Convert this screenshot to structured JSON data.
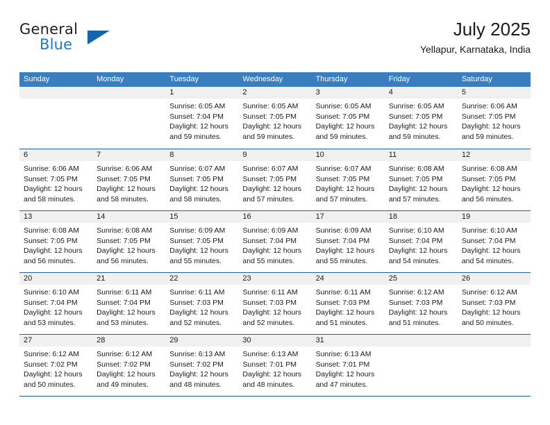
{
  "brand": {
    "name_top": "General",
    "name_bottom": "Blue",
    "triangle_icon": "triangle-icon",
    "color_dark": "#231f20",
    "color_blue": "#1f7ac4",
    "triangle_color": "#1565ac"
  },
  "header": {
    "title": "July 2025",
    "subtitle": "Yellapur, Karnataka, India"
  },
  "theme": {
    "header_bar": "#3a7ebf",
    "row_divider": "#1f5fa0",
    "date_band": "#f0f0f0",
    "text": "#1a1a1a"
  },
  "weekdays": [
    "Sunday",
    "Monday",
    "Tuesday",
    "Wednesday",
    "Thursday",
    "Friday",
    "Saturday"
  ],
  "weeks": [
    [
      {
        "day": "",
        "sunrise": "",
        "sunset": "",
        "daylight_line1": "",
        "daylight_line2": "",
        "empty": true
      },
      {
        "day": "",
        "sunrise": "",
        "sunset": "",
        "daylight_line1": "",
        "daylight_line2": "",
        "empty": true
      },
      {
        "day": "1",
        "sunrise": "Sunrise: 6:05 AM",
        "sunset": "Sunset: 7:04 PM",
        "daylight_line1": "Daylight: 12 hours",
        "daylight_line2": "and 59 minutes.",
        "empty": false
      },
      {
        "day": "2",
        "sunrise": "Sunrise: 6:05 AM",
        "sunset": "Sunset: 7:05 PM",
        "daylight_line1": "Daylight: 12 hours",
        "daylight_line2": "and 59 minutes.",
        "empty": false
      },
      {
        "day": "3",
        "sunrise": "Sunrise: 6:05 AM",
        "sunset": "Sunset: 7:05 PM",
        "daylight_line1": "Daylight: 12 hours",
        "daylight_line2": "and 59 minutes.",
        "empty": false
      },
      {
        "day": "4",
        "sunrise": "Sunrise: 6:05 AM",
        "sunset": "Sunset: 7:05 PM",
        "daylight_line1": "Daylight: 12 hours",
        "daylight_line2": "and 59 minutes.",
        "empty": false
      },
      {
        "day": "5",
        "sunrise": "Sunrise: 6:06 AM",
        "sunset": "Sunset: 7:05 PM",
        "daylight_line1": "Daylight: 12 hours",
        "daylight_line2": "and 59 minutes.",
        "empty": false
      }
    ],
    [
      {
        "day": "6",
        "sunrise": "Sunrise: 6:06 AM",
        "sunset": "Sunset: 7:05 PM",
        "daylight_line1": "Daylight: 12 hours",
        "daylight_line2": "and 58 minutes.",
        "empty": false
      },
      {
        "day": "7",
        "sunrise": "Sunrise: 6:06 AM",
        "sunset": "Sunset: 7:05 PM",
        "daylight_line1": "Daylight: 12 hours",
        "daylight_line2": "and 58 minutes.",
        "empty": false
      },
      {
        "day": "8",
        "sunrise": "Sunrise: 6:07 AM",
        "sunset": "Sunset: 7:05 PM",
        "daylight_line1": "Daylight: 12 hours",
        "daylight_line2": "and 58 minutes.",
        "empty": false
      },
      {
        "day": "9",
        "sunrise": "Sunrise: 6:07 AM",
        "sunset": "Sunset: 7:05 PM",
        "daylight_line1": "Daylight: 12 hours",
        "daylight_line2": "and 57 minutes.",
        "empty": false
      },
      {
        "day": "10",
        "sunrise": "Sunrise: 6:07 AM",
        "sunset": "Sunset: 7:05 PM",
        "daylight_line1": "Daylight: 12 hours",
        "daylight_line2": "and 57 minutes.",
        "empty": false
      },
      {
        "day": "11",
        "sunrise": "Sunrise: 6:08 AM",
        "sunset": "Sunset: 7:05 PM",
        "daylight_line1": "Daylight: 12 hours",
        "daylight_line2": "and 57 minutes.",
        "empty": false
      },
      {
        "day": "12",
        "sunrise": "Sunrise: 6:08 AM",
        "sunset": "Sunset: 7:05 PM",
        "daylight_line1": "Daylight: 12 hours",
        "daylight_line2": "and 56 minutes.",
        "empty": false
      }
    ],
    [
      {
        "day": "13",
        "sunrise": "Sunrise: 6:08 AM",
        "sunset": "Sunset: 7:05 PM",
        "daylight_line1": "Daylight: 12 hours",
        "daylight_line2": "and 56 minutes.",
        "empty": false
      },
      {
        "day": "14",
        "sunrise": "Sunrise: 6:08 AM",
        "sunset": "Sunset: 7:05 PM",
        "daylight_line1": "Daylight: 12 hours",
        "daylight_line2": "and 56 minutes.",
        "empty": false
      },
      {
        "day": "15",
        "sunrise": "Sunrise: 6:09 AM",
        "sunset": "Sunset: 7:05 PM",
        "daylight_line1": "Daylight: 12 hours",
        "daylight_line2": "and 55 minutes.",
        "empty": false
      },
      {
        "day": "16",
        "sunrise": "Sunrise: 6:09 AM",
        "sunset": "Sunset: 7:04 PM",
        "daylight_line1": "Daylight: 12 hours",
        "daylight_line2": "and 55 minutes.",
        "empty": false
      },
      {
        "day": "17",
        "sunrise": "Sunrise: 6:09 AM",
        "sunset": "Sunset: 7:04 PM",
        "daylight_line1": "Daylight: 12 hours",
        "daylight_line2": "and 55 minutes.",
        "empty": false
      },
      {
        "day": "18",
        "sunrise": "Sunrise: 6:10 AM",
        "sunset": "Sunset: 7:04 PM",
        "daylight_line1": "Daylight: 12 hours",
        "daylight_line2": "and 54 minutes.",
        "empty": false
      },
      {
        "day": "19",
        "sunrise": "Sunrise: 6:10 AM",
        "sunset": "Sunset: 7:04 PM",
        "daylight_line1": "Daylight: 12 hours",
        "daylight_line2": "and 54 minutes.",
        "empty": false
      }
    ],
    [
      {
        "day": "20",
        "sunrise": "Sunrise: 6:10 AM",
        "sunset": "Sunset: 7:04 PM",
        "daylight_line1": "Daylight: 12 hours",
        "daylight_line2": "and 53 minutes.",
        "empty": false
      },
      {
        "day": "21",
        "sunrise": "Sunrise: 6:11 AM",
        "sunset": "Sunset: 7:04 PM",
        "daylight_line1": "Daylight: 12 hours",
        "daylight_line2": "and 53 minutes.",
        "empty": false
      },
      {
        "day": "22",
        "sunrise": "Sunrise: 6:11 AM",
        "sunset": "Sunset: 7:03 PM",
        "daylight_line1": "Daylight: 12 hours",
        "daylight_line2": "and 52 minutes.",
        "empty": false
      },
      {
        "day": "23",
        "sunrise": "Sunrise: 6:11 AM",
        "sunset": "Sunset: 7:03 PM",
        "daylight_line1": "Daylight: 12 hours",
        "daylight_line2": "and 52 minutes.",
        "empty": false
      },
      {
        "day": "24",
        "sunrise": "Sunrise: 6:11 AM",
        "sunset": "Sunset: 7:03 PM",
        "daylight_line1": "Daylight: 12 hours",
        "daylight_line2": "and 51 minutes.",
        "empty": false
      },
      {
        "day": "25",
        "sunrise": "Sunrise: 6:12 AM",
        "sunset": "Sunset: 7:03 PM",
        "daylight_line1": "Daylight: 12 hours",
        "daylight_line2": "and 51 minutes.",
        "empty": false
      },
      {
        "day": "26",
        "sunrise": "Sunrise: 6:12 AM",
        "sunset": "Sunset: 7:03 PM",
        "daylight_line1": "Daylight: 12 hours",
        "daylight_line2": "and 50 minutes.",
        "empty": false
      }
    ],
    [
      {
        "day": "27",
        "sunrise": "Sunrise: 6:12 AM",
        "sunset": "Sunset: 7:02 PM",
        "daylight_line1": "Daylight: 12 hours",
        "daylight_line2": "and 50 minutes.",
        "empty": false
      },
      {
        "day": "28",
        "sunrise": "Sunrise: 6:12 AM",
        "sunset": "Sunset: 7:02 PM",
        "daylight_line1": "Daylight: 12 hours",
        "daylight_line2": "and 49 minutes.",
        "empty": false
      },
      {
        "day": "29",
        "sunrise": "Sunrise: 6:13 AM",
        "sunset": "Sunset: 7:02 PM",
        "daylight_line1": "Daylight: 12 hours",
        "daylight_line2": "and 48 minutes.",
        "empty": false
      },
      {
        "day": "30",
        "sunrise": "Sunrise: 6:13 AM",
        "sunset": "Sunset: 7:01 PM",
        "daylight_line1": "Daylight: 12 hours",
        "daylight_line2": "and 48 minutes.",
        "empty": false
      },
      {
        "day": "31",
        "sunrise": "Sunrise: 6:13 AM",
        "sunset": "Sunset: 7:01 PM",
        "daylight_line1": "Daylight: 12 hours",
        "daylight_line2": "and 47 minutes.",
        "empty": false
      },
      {
        "day": "",
        "sunrise": "",
        "sunset": "",
        "daylight_line1": "",
        "daylight_line2": "",
        "empty": true
      },
      {
        "day": "",
        "sunrise": "",
        "sunset": "",
        "daylight_line1": "",
        "daylight_line2": "",
        "empty": true
      }
    ]
  ]
}
